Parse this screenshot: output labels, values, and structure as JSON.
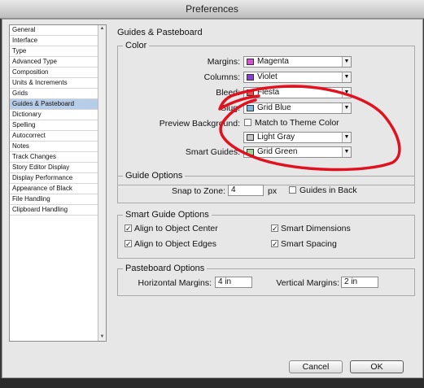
{
  "window": {
    "title": "Preferences"
  },
  "sidebar": {
    "items": [
      "General",
      "Interface",
      "Type",
      "Advanced Type",
      "Composition",
      "Units & Increments",
      "Grids",
      "Guides & Pasteboard",
      "Dictionary",
      "Spelling",
      "Autocorrect",
      "Notes",
      "Track Changes",
      "Story Editor Display",
      "Display Performance",
      "Appearance of Black",
      "File Handling",
      "Clipboard Handling"
    ],
    "selected_index": 7
  },
  "pane": {
    "title": "Guides & Pasteboard"
  },
  "color_group": {
    "legend": "Color",
    "margins": {
      "label": "Margins:",
      "value": "Magenta",
      "swatch": "#d84fd6"
    },
    "columns": {
      "label": "Columns:",
      "value": "Violet",
      "swatch": "#8b3fd1"
    },
    "bleed": {
      "label": "Bleed:",
      "value": "Fiesta",
      "swatch": "#e8504f"
    },
    "slug": {
      "label": "Slug:",
      "value": "Grid Blue",
      "swatch": "#7fb6e0"
    },
    "preview_background": {
      "label": "Preview Background:",
      "checkbox_label": "Match to Theme Color",
      "checked": false,
      "value": "Light Gray",
      "swatch": "#c8c8c8"
    },
    "smart_guides": {
      "label": "Smart Guides:",
      "value": "Grid Green",
      "swatch": "#9fd49a"
    }
  },
  "guide_options": {
    "legend": "Guide Options",
    "snap_label": "Snap to Zone:",
    "snap_value": "4",
    "snap_unit": "px",
    "guides_in_back_label": "Guides in Back",
    "guides_in_back_checked": false
  },
  "smart_guide_options": {
    "legend": "Smart Guide Options",
    "align_center": {
      "label": "Align to Object Center",
      "checked": true
    },
    "align_edges": {
      "label": "Align to Object Edges",
      "checked": true
    },
    "smart_dimensions": {
      "label": "Smart Dimensions",
      "checked": true
    },
    "smart_spacing": {
      "label": "Smart Spacing",
      "checked": true
    }
  },
  "pasteboard_options": {
    "legend": "Pasteboard Options",
    "horizontal_label": "Horizontal Margins:",
    "horizontal_value": "4 in",
    "vertical_label": "Vertical Margins:",
    "vertical_value": "2 in"
  },
  "buttons": {
    "cancel": "Cancel",
    "ok": "OK"
  },
  "annotation": {
    "stroke_color": "#e0121f"
  },
  "colors": {
    "selected_row": "#b7cde8",
    "window_bg": "#e7e7e7"
  }
}
